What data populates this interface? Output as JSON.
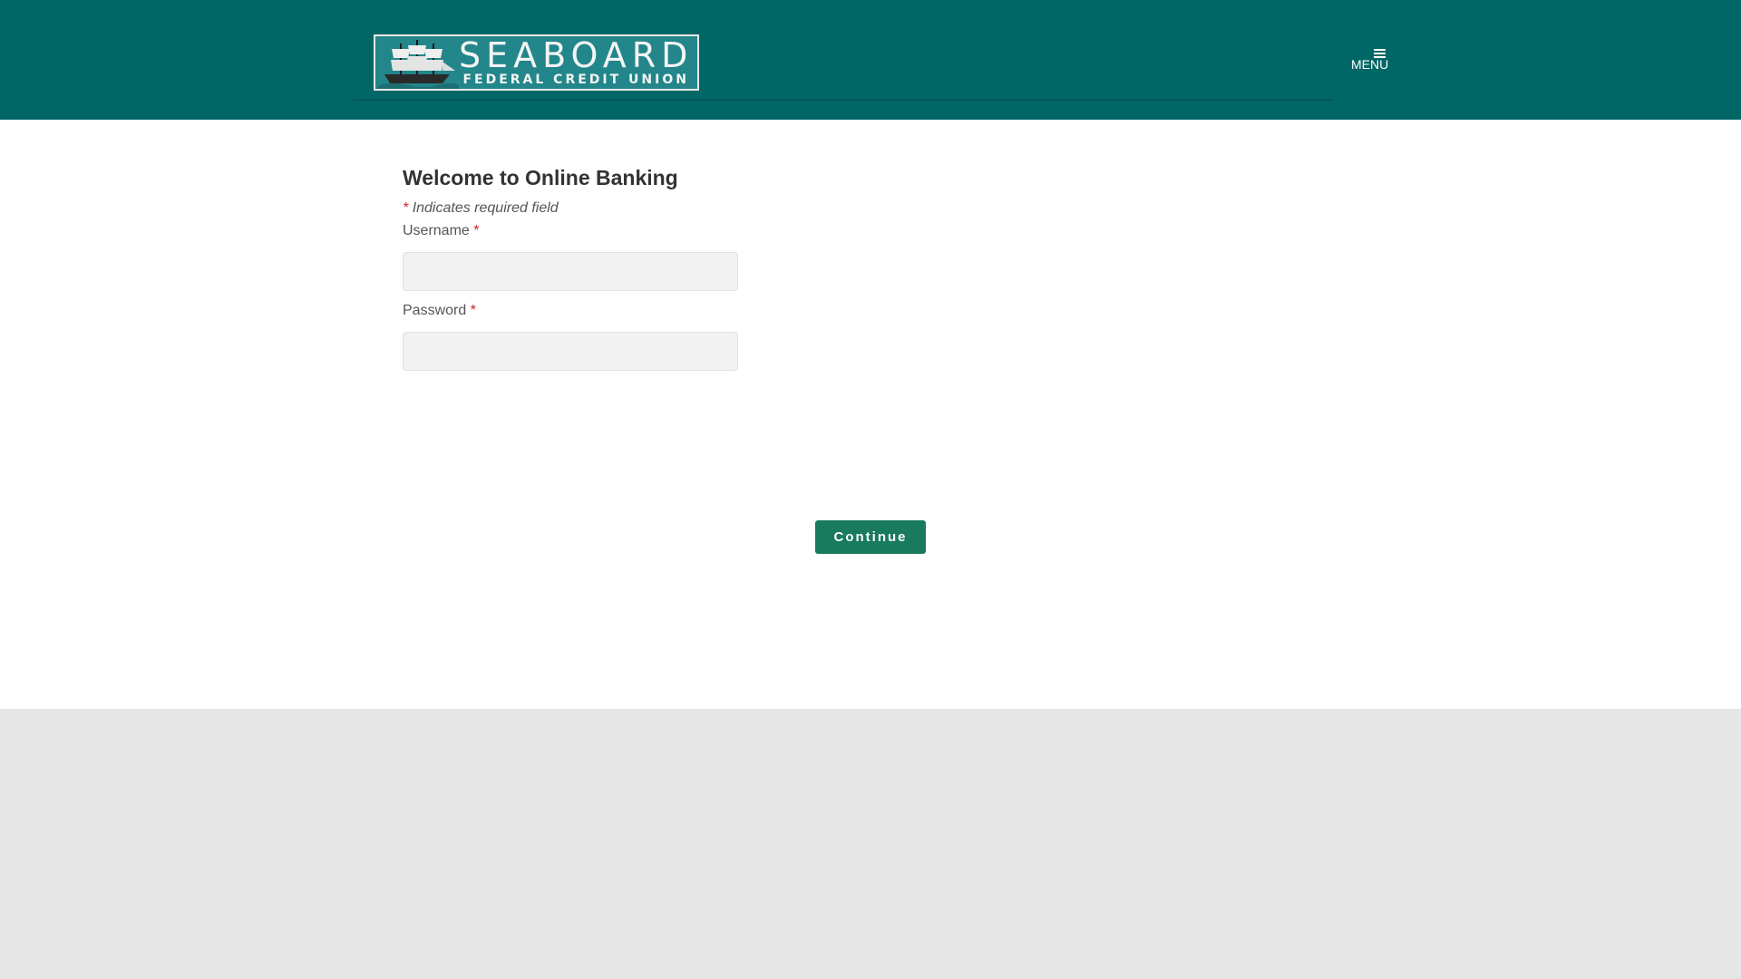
{
  "header": {
    "logo": {
      "title": "SEABOARD",
      "subtitle": "FEDERAL CREDIT UNION"
    },
    "menu_label": "MENU"
  },
  "login": {
    "title": "Welcome to Online Banking",
    "required_marker": "*",
    "required_note": "Indicates required field",
    "username_label": "Username",
    "username_value": "",
    "password_label": "Password",
    "password_value": "",
    "continue_label": "Continue"
  },
  "colors": {
    "header_bg": "#006666",
    "button_bg": "#1a7a5e",
    "required": "#cc2222",
    "footer_bg": "#e6e6e6"
  }
}
